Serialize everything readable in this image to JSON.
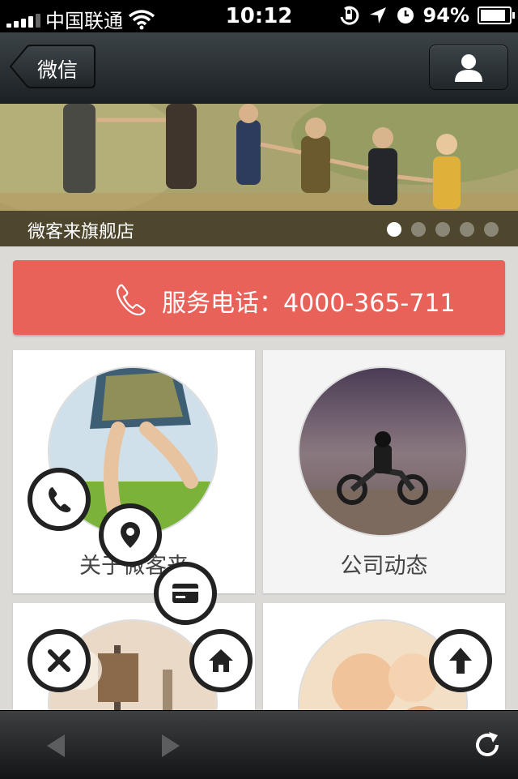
{
  "status_bar": {
    "carrier": "中国联通",
    "time": "10:12",
    "battery": "94%",
    "battery_level": 0.94
  },
  "nav": {
    "back_label": "微信"
  },
  "banner": {
    "caption": "微客来旗舰店",
    "slide_count": 5,
    "active_slide": 1
  },
  "service": {
    "label": "服务电话：4000-365-711"
  },
  "tiles": [
    {
      "title": "关于微客来"
    },
    {
      "title": "公司动态"
    },
    {
      "title": ""
    },
    {
      "title": ""
    }
  ],
  "floating_menu": {
    "icons": [
      "phone-icon",
      "location-icon",
      "card-icon",
      "close-icon",
      "home-icon",
      "arrow-up-icon"
    ]
  },
  "colors": {
    "accent": "#e8625a",
    "nav_bg": "#2a3035",
    "menu_border": "#222222"
  }
}
